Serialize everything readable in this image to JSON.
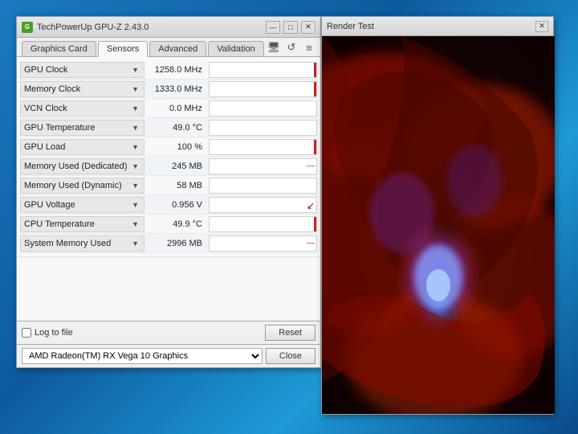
{
  "gpuz_window": {
    "title": "TechPowerUp GPU-Z 2.43.0",
    "min_btn": "—",
    "max_btn": "□",
    "close_btn": "✕",
    "tabs": [
      {
        "id": "graphics-card",
        "label": "Graphics Card",
        "active": false
      },
      {
        "id": "sensors",
        "label": "Sensors",
        "active": true
      },
      {
        "id": "advanced",
        "label": "Advanced",
        "active": false
      },
      {
        "id": "validation",
        "label": "Validation",
        "active": false
      }
    ],
    "toolbar_icons": {
      "camera": "📷",
      "refresh": "↺",
      "menu": "≡"
    },
    "sensors": [
      {
        "name": "GPU Clock",
        "value": "1258.0 MHz",
        "bar_type": "small"
      },
      {
        "name": "Memory Clock",
        "value": "1333.0 MHz",
        "bar_type": "small"
      },
      {
        "name": "VCN Clock",
        "value": "0.0 MHz",
        "bar_type": "none"
      },
      {
        "name": "GPU Temperature",
        "value": "49.0 °C",
        "bar_type": "none"
      },
      {
        "name": "GPU Load",
        "value": "100 %",
        "bar_type": "small"
      },
      {
        "name": "Memory Used (Dedicated)",
        "value": "245 MB",
        "bar_type": "dash"
      },
      {
        "name": "Memory Used (Dynamic)",
        "value": "58 MB",
        "bar_type": "none"
      },
      {
        "name": "GPU Voltage",
        "value": "0.956 V",
        "bar_type": "arrow"
      },
      {
        "name": "CPU Temperature",
        "value": "49.9 °C",
        "bar_type": "small"
      },
      {
        "name": "System Memory Used",
        "value": "2996 MB",
        "bar_type": "dash"
      }
    ],
    "bottom": {
      "log_checkbox": false,
      "log_label": "Log to file",
      "reset_btn": "Reset",
      "close_btn": "Close"
    },
    "gpu_select": {
      "value": "AMD Radeon(TM) RX Vega 10 Graphics"
    }
  },
  "render_window": {
    "title": "Render Test",
    "close_btn": "✕"
  }
}
